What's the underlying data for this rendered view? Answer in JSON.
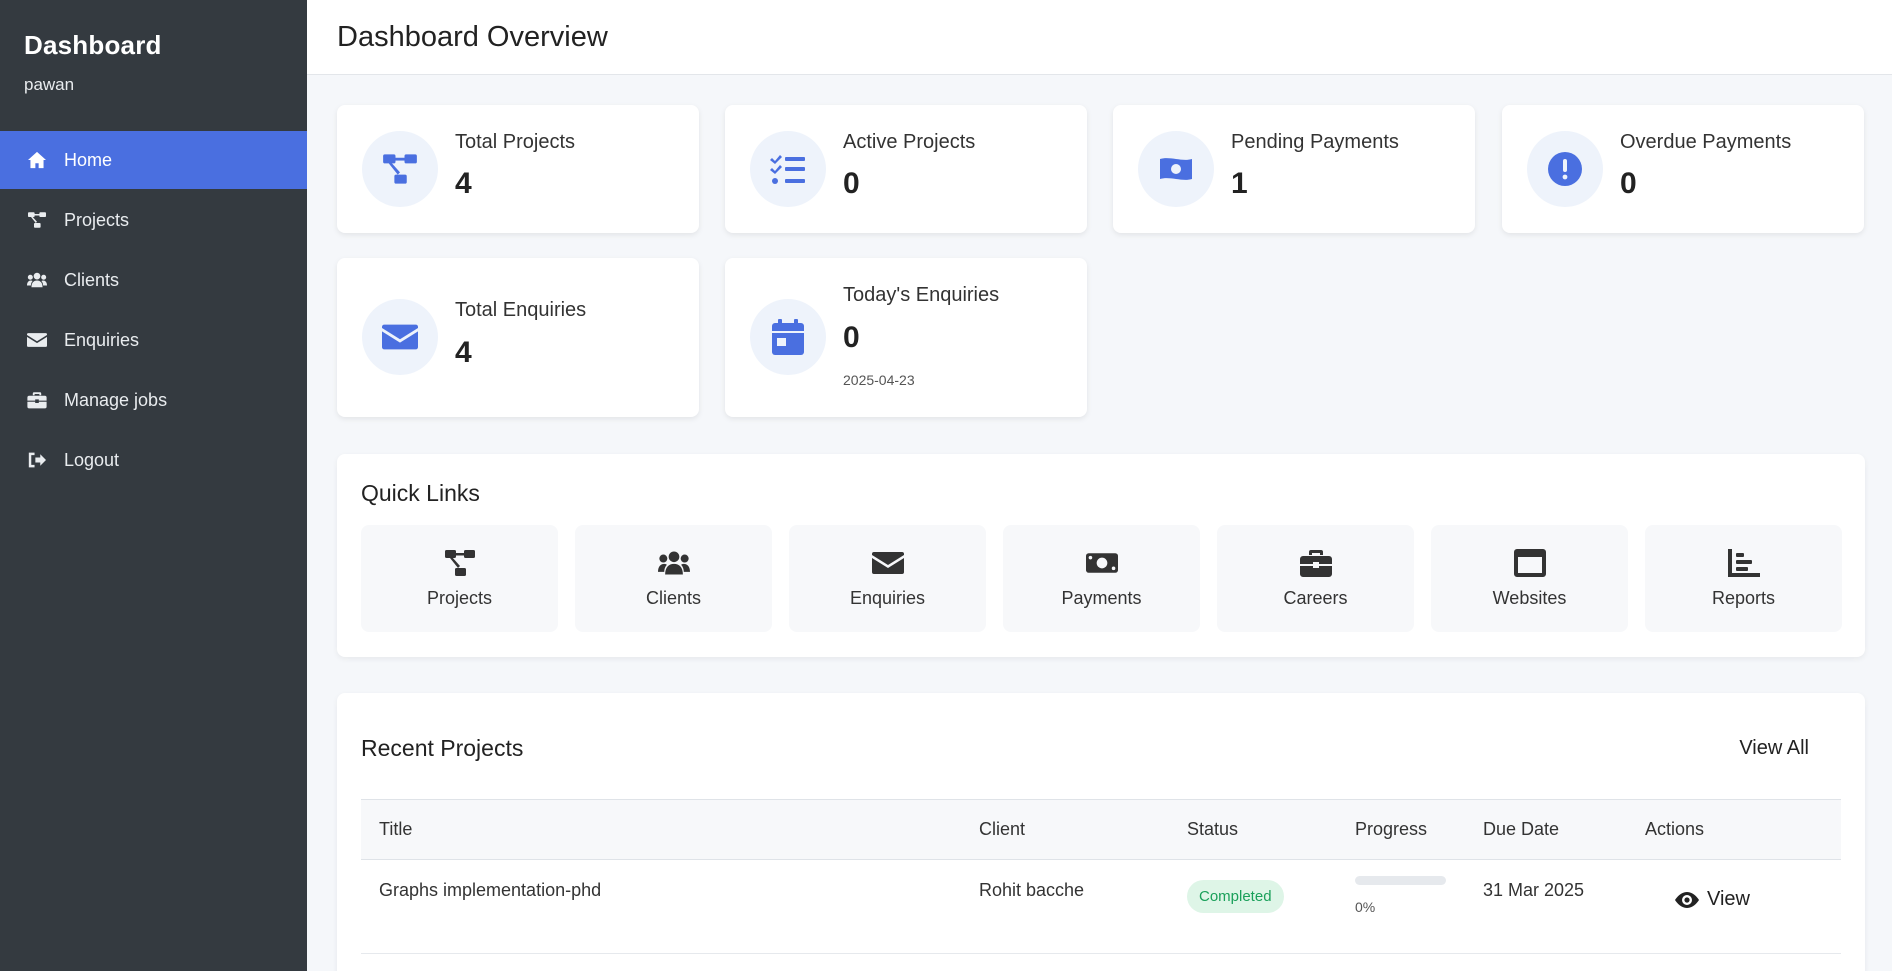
{
  "sidebar": {
    "title": "Dashboard",
    "user": "pawan",
    "items": [
      {
        "label": "Home",
        "icon": "home-icon",
        "active": true
      },
      {
        "label": "Projects",
        "icon": "project-diagram-icon"
      },
      {
        "label": "Clients",
        "icon": "users-icon"
      },
      {
        "label": "Enquiries",
        "icon": "envelope-icon"
      },
      {
        "label": "Manage jobs",
        "icon": "briefcase-icon"
      },
      {
        "label": "Logout",
        "icon": "sign-out-icon"
      }
    ]
  },
  "header": {
    "title": "Dashboard Overview"
  },
  "stats": [
    {
      "label": "Total Projects",
      "value": "4",
      "icon": "project-diagram-icon"
    },
    {
      "label": "Active Projects",
      "value": "0",
      "icon": "tasks-icon"
    },
    {
      "label": "Pending Payments",
      "value": "1",
      "icon": "money-bill-icon"
    },
    {
      "label": "Overdue Payments",
      "value": "0",
      "icon": "exclamation-circle-icon"
    },
    {
      "label": "Total Enquiries",
      "value": "4",
      "icon": "envelope-icon"
    },
    {
      "label": "Today's Enquiries",
      "value": "0",
      "sub": "2025-04-23",
      "icon": "calendar-icon"
    }
  ],
  "quick_links": {
    "title": "Quick Links",
    "items": [
      {
        "label": "Projects",
        "icon": "project-diagram-icon"
      },
      {
        "label": "Clients",
        "icon": "users-icon"
      },
      {
        "label": "Enquiries",
        "icon": "envelope-icon"
      },
      {
        "label": "Payments",
        "icon": "money-bill-icon"
      },
      {
        "label": "Careers",
        "icon": "briefcase-icon"
      },
      {
        "label": "Websites",
        "icon": "browser-window-icon"
      },
      {
        "label": "Reports",
        "icon": "chart-bar-icon"
      }
    ]
  },
  "recent_projects": {
    "title": "Recent Projects",
    "view_all": "View All",
    "columns": [
      "Title",
      "Client",
      "Status",
      "Progress",
      "Due Date",
      "Actions"
    ],
    "rows": [
      {
        "title": "Graphs implementation-phd",
        "client": "Rohit bacche",
        "status": "Completed",
        "progress_percent": 0,
        "progress_label": "0%",
        "due": "31 Mar 2025",
        "action": "View"
      }
    ]
  },
  "colors": {
    "accent": "#4a6fe0",
    "sidebar_bg": "#343a40",
    "badge_bg": "#def5e7",
    "badge_text": "#1aa05a"
  }
}
